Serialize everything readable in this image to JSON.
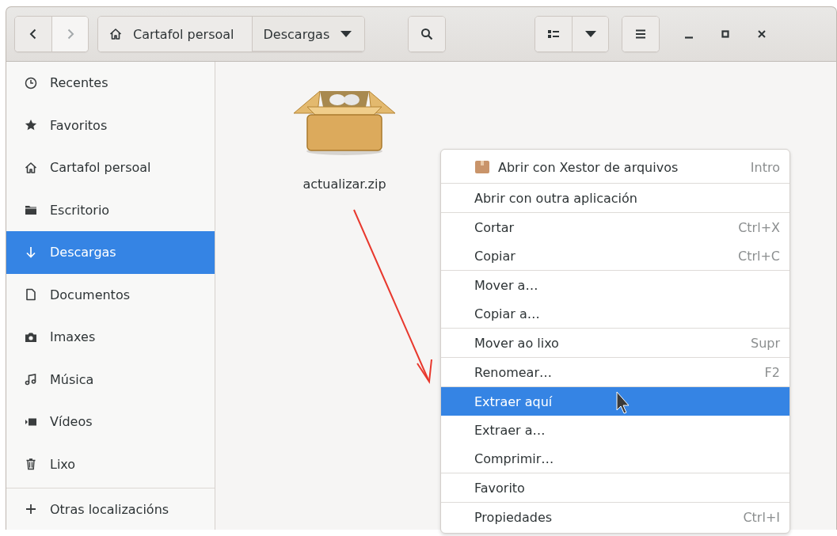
{
  "headerbar": {
    "back": {
      "disabled": false
    },
    "forward": {
      "disabled": true
    },
    "path": [
      {
        "label": "Cartafol persoal",
        "kind": "home",
        "selected": false
      },
      {
        "label": "Descargas",
        "kind": "dropdown",
        "selected": true
      }
    ]
  },
  "sidebar": {
    "items": [
      {
        "label": "Recentes",
        "kind": "clock",
        "selected": false
      },
      {
        "label": "Favoritos",
        "kind": "star",
        "selected": false
      },
      {
        "label": "Cartafol persoal",
        "kind": "home",
        "selected": false
      },
      {
        "label": "Escritorio",
        "kind": "folder",
        "selected": false
      },
      {
        "label": "Descargas",
        "kind": "download",
        "selected": true
      },
      {
        "label": "Documentos",
        "kind": "document",
        "selected": false
      },
      {
        "label": "Imaxes",
        "kind": "camera",
        "selected": false
      },
      {
        "label": "Música",
        "kind": "music",
        "selected": false
      },
      {
        "label": "Vídeos",
        "kind": "video",
        "selected": false
      },
      {
        "label": "Lixo",
        "kind": "trash",
        "selected": false
      }
    ],
    "other": {
      "label": "Otras localizacións"
    }
  },
  "files": [
    {
      "name": "actualizar.zip",
      "kind": "archive"
    }
  ],
  "context_menu": {
    "sections": [
      [
        {
          "label": "Abrir con Xestor de arquivos",
          "shortcut": "Intro",
          "kind": "app",
          "selected": false
        }
      ],
      [
        {
          "label": "Abrir con outra aplicación",
          "kind": "plain",
          "selected": false
        }
      ],
      [
        {
          "label": "Cortar",
          "shortcut": "Ctrl+X",
          "kind": "plain",
          "selected": false
        },
        {
          "label": "Copiar",
          "shortcut": "Ctrl+C",
          "kind": "plain",
          "selected": false
        }
      ],
      [
        {
          "label": "Mover a…",
          "kind": "plain",
          "selected": false
        },
        {
          "label": "Copiar a…",
          "kind": "plain",
          "selected": false
        }
      ],
      [
        {
          "label": "Mover ao lixo",
          "shortcut": "Supr",
          "kind": "plain",
          "selected": false
        }
      ],
      [
        {
          "label": "Renomear…",
          "shortcut": "F2",
          "kind": "plain",
          "selected": false
        }
      ],
      [
        {
          "label": "Extraer aquí",
          "kind": "plain",
          "selected": true
        },
        {
          "label": "Extraer a…",
          "kind": "plain",
          "selected": false
        },
        {
          "label": "Comprimir…",
          "kind": "plain",
          "selected": false
        }
      ],
      [
        {
          "label": "Favorito",
          "kind": "plain",
          "selected": false
        }
      ],
      [
        {
          "label": "Propiedades",
          "shortcut": "Ctrl+I",
          "kind": "plain",
          "selected": false
        }
      ]
    ]
  }
}
